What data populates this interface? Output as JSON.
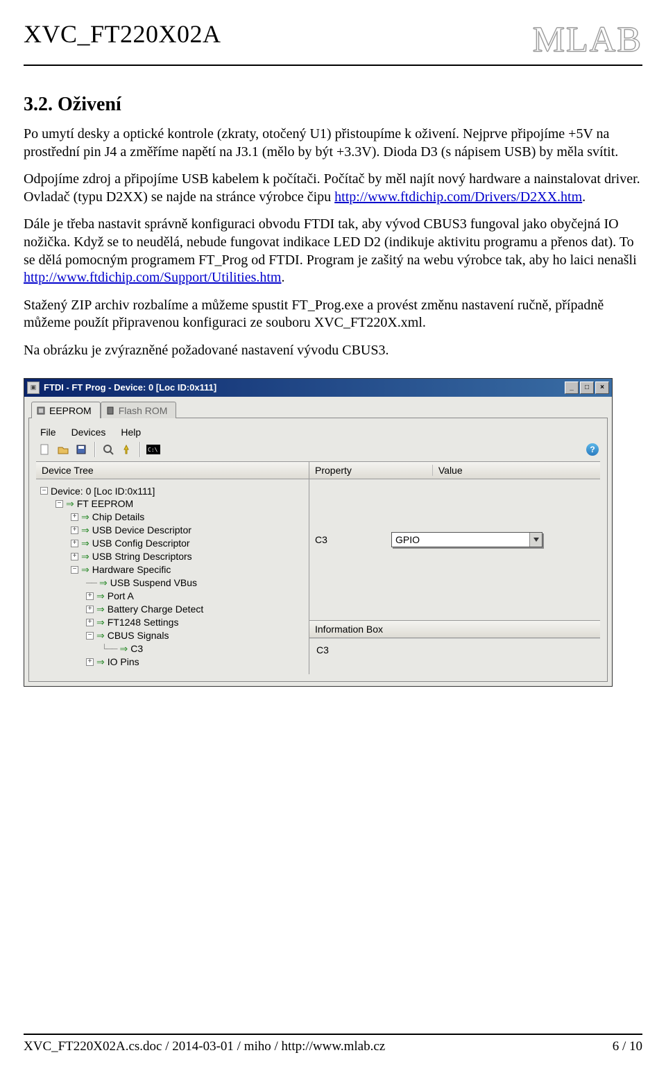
{
  "header": {
    "doc_title": "XVC_FT220X02A",
    "logo_text": "MLAB"
  },
  "section": {
    "number": "3.2.",
    "title": "Oživení"
  },
  "paragraphs": {
    "p1": "Po umytí desky a optické kontrole (zkraty, otočený U1) přistoupíme k oživení. Nejprve připojíme +5V na prostřední pin J4 a změříme napětí na J3.1 (mělo by být +3.3V). Dioda D3 (s nápisem USB) by měla svítit.",
    "p2_before": "Odpojíme zdroj a připojíme USB kabelem k počítači. Počítač by měl najít nový hardware a nainstalovat driver. Ovladač (typu D2XX) se najde na stránce výrobce čipu ",
    "p2_link": "http://www.ftdichip.com/Drivers/D2XX.htm",
    "p2_after": ".",
    "p3_before": "Dále je třeba nastavit správně konfiguraci obvodu FTDI tak, aby vývod CBUS3 fungoval jako obyčejná IO nožička. Když se to neudělá, nebude fungovat indikace LED D2 (indikuje aktivitu programu a přenos dat). To se dělá pomocným programem FT_Prog od FTDI. Program je zašitý na webu výrobce tak, aby ho laici nenašli ",
    "p3_link": "http://www.ftdichip.com/Support/Utilities.htm",
    "p3_after": ".",
    "p4": "Stažený ZIP archiv rozbalíme a můžeme spustit FT_Prog.exe a provést změnu nastavení ručně, případně můžeme použít připravenou konfiguraci ze souboru  XVC_FT220X.xml.",
    "p5": "Na obrázku je zvýrazněné požadované nastavení vývodu CBUS3."
  },
  "app": {
    "window_title": "FTDI - FT Prog - Device: 0 [Loc ID:0x111]",
    "tabs": {
      "eeprom": "EEPROM",
      "flashrom": "Flash ROM"
    },
    "menu": {
      "file": "File",
      "devices": "Devices",
      "help": "Help"
    },
    "columns": {
      "left": "Device Tree",
      "property": "Property",
      "value": "Value",
      "infobox": "Information Box"
    },
    "tree": {
      "root": "Device: 0 [Loc ID:0x111]",
      "fteeprom": "FT EEPROM",
      "items": [
        "Chip Details",
        "USB Device Descriptor",
        "USB Config Descriptor",
        "USB String Descriptors",
        "Hardware Specific"
      ],
      "hw": {
        "suspend": "USB Suspend VBus",
        "porta": "Port A",
        "battery": "Battery Charge Detect",
        "ft1248": "FT1248 Settings",
        "cbus": "CBUS Signals",
        "c3": "C3",
        "iopins": "IO Pins"
      }
    },
    "property": {
      "label": "C3",
      "value": "GPIO"
    },
    "info": {
      "c3": "C3"
    }
  },
  "footer": {
    "left": "XVC_FT220X02A.cs.doc / 2014-03-01 / miho / http://www.mlab.cz",
    "right": "6 / 10"
  }
}
